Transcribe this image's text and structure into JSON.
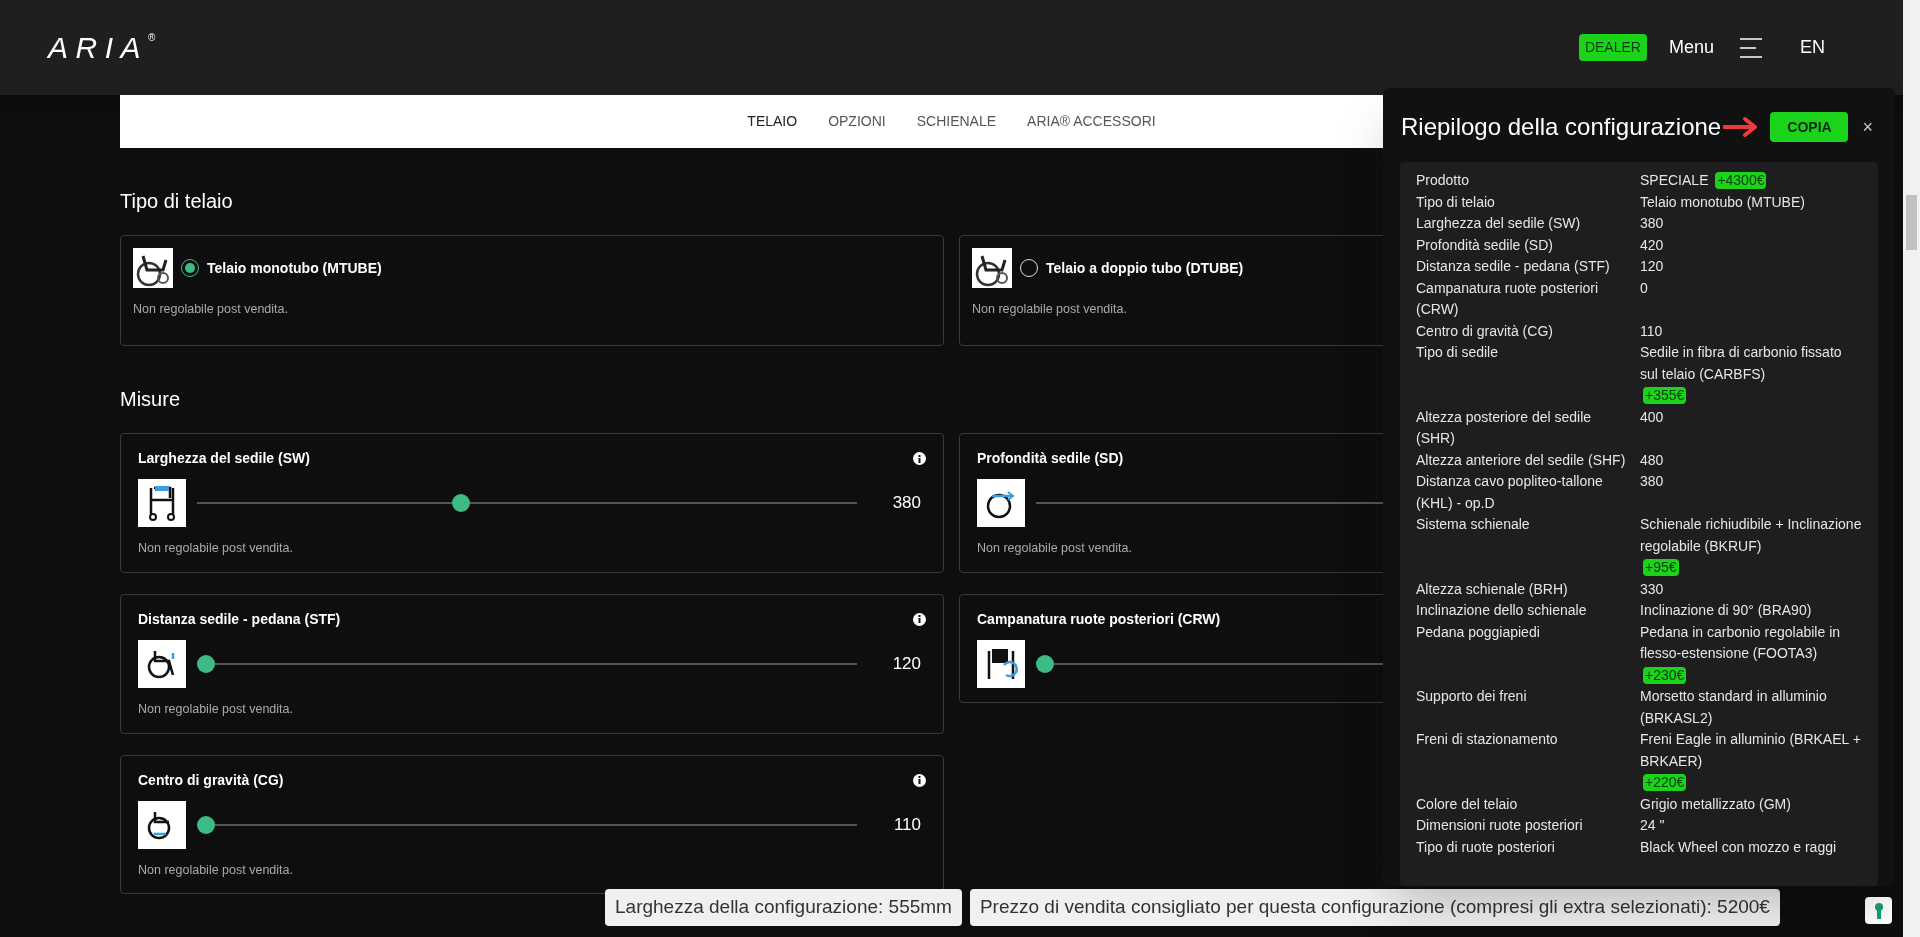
{
  "header": {
    "logo": "ARIA",
    "logo_mark": "®",
    "dealer_badge": "DEALER",
    "menu_label": "Menu",
    "language": "EN"
  },
  "nav": {
    "items": [
      {
        "label": "TELAIO",
        "selected": true
      },
      {
        "label": "OPZIONI",
        "selected": false
      },
      {
        "label": "SCHIENALE",
        "selected": false
      },
      {
        "label": "ARIA® ACCESSORI",
        "selected": false
      }
    ]
  },
  "frame_section": {
    "title": "Tipo di telaio",
    "options": [
      {
        "label": "Telaio monotubo (MTUBE)",
        "selected": true,
        "note": "Non regolabile post vendita."
      },
      {
        "label": "Telaio a doppio tubo (DTUBE)",
        "selected": false,
        "note": "Non regolabile post vendita."
      }
    ]
  },
  "measures_section": {
    "title": "Misure",
    "sliders": [
      {
        "label": "Larghezza del sedile (SW)",
        "level": 0.4,
        "reading": "380",
        "note": "Non regolabile post vendita.",
        "info": true
      },
      {
        "label": "Profondità sedile (SD)",
        "note": "Non regolabile post vendita.",
        "info": false
      },
      {
        "label": "Distanza sedile - pedana (STF)",
        "level": 0,
        "reading": "120",
        "note": "Non regolabile post vendita.",
        "info": true
      },
      {
        "label": "Campanatura ruote posteriori (CRW)",
        "level": 0,
        "info": false
      },
      {
        "label": "Centro di gravità (CG)",
        "level": 0,
        "reading": "110",
        "note": "Non regolabile post vendita.",
        "info": true
      }
    ]
  },
  "summary_panel": {
    "title": "Riepilogo della configurazione",
    "copy_button": "COPIA",
    "close": "×",
    "rows": [
      {
        "label": "Prodotto",
        "value": "SPECIALE",
        "extra": "+4300€"
      },
      {
        "label": "Tipo di telaio",
        "value": "Telaio monotubo (MTUBE)"
      },
      {
        "label": "Larghezza del sedile (SW)",
        "value": "380"
      },
      {
        "label": "Profondità sedile (SD)",
        "value": "420"
      },
      {
        "label": "Distanza sedile - pedana (STF)",
        "value": "120"
      },
      {
        "label": "Campanatura ruote posteriori (CRW)",
        "value": "0"
      },
      {
        "label": "Centro di gravità (CG)",
        "value": "110"
      },
      {
        "label": "Tipo di sedile",
        "value": "Sedile in fibra di carbonio fissato sul telaio (CARBFS)",
        "extra": "+355€"
      },
      {
        "label": "Altezza posteriore del sedile (SHR)",
        "value": "400"
      },
      {
        "label": "Altezza anteriore del sedile (SHF)",
        "value": "480"
      },
      {
        "label": "Distanza cavo popliteo-tallone (KHL) - op.D",
        "value": "380"
      },
      {
        "label": "Sistema schienale",
        "value": "Schienale richiudibile + Inclinazione regolabile (BKRUF)",
        "extra": "+95€"
      },
      {
        "label": "Altezza schienale (BRH)",
        "value": "330"
      },
      {
        "label": "Inclinazione dello schienale",
        "value": "Inclinazione di 90° (BRA90)"
      },
      {
        "label": "Pedana poggiapiedi",
        "value": "Pedana in carbonio regolabile in flesso-estensione (FOOTA3)",
        "extra": "+230€"
      },
      {
        "label": "Supporto dei freni",
        "value": "Morsetto standard in alluminio (BRKASL2)"
      },
      {
        "label": "Freni di stazionamento",
        "value": "Freni Eagle in alluminio (BRKAEL + BRKAER)",
        "extra": "+220€"
      },
      {
        "label": "Colore del telaio",
        "value": "Grigio metallizzato (GM)"
      },
      {
        "label": "Dimensioni ruote posteriori",
        "value": "24 \""
      },
      {
        "label": "Tipo di ruote posteriori",
        "value": "Black Wheel con mozzo e raggi"
      }
    ]
  },
  "footer": {
    "width_info": "Larghezza della configurazione: 555mm",
    "price_info": "Prezzo di vendita consigliato per questa configurazione (compresi gli extra selezionati): 5200€"
  }
}
